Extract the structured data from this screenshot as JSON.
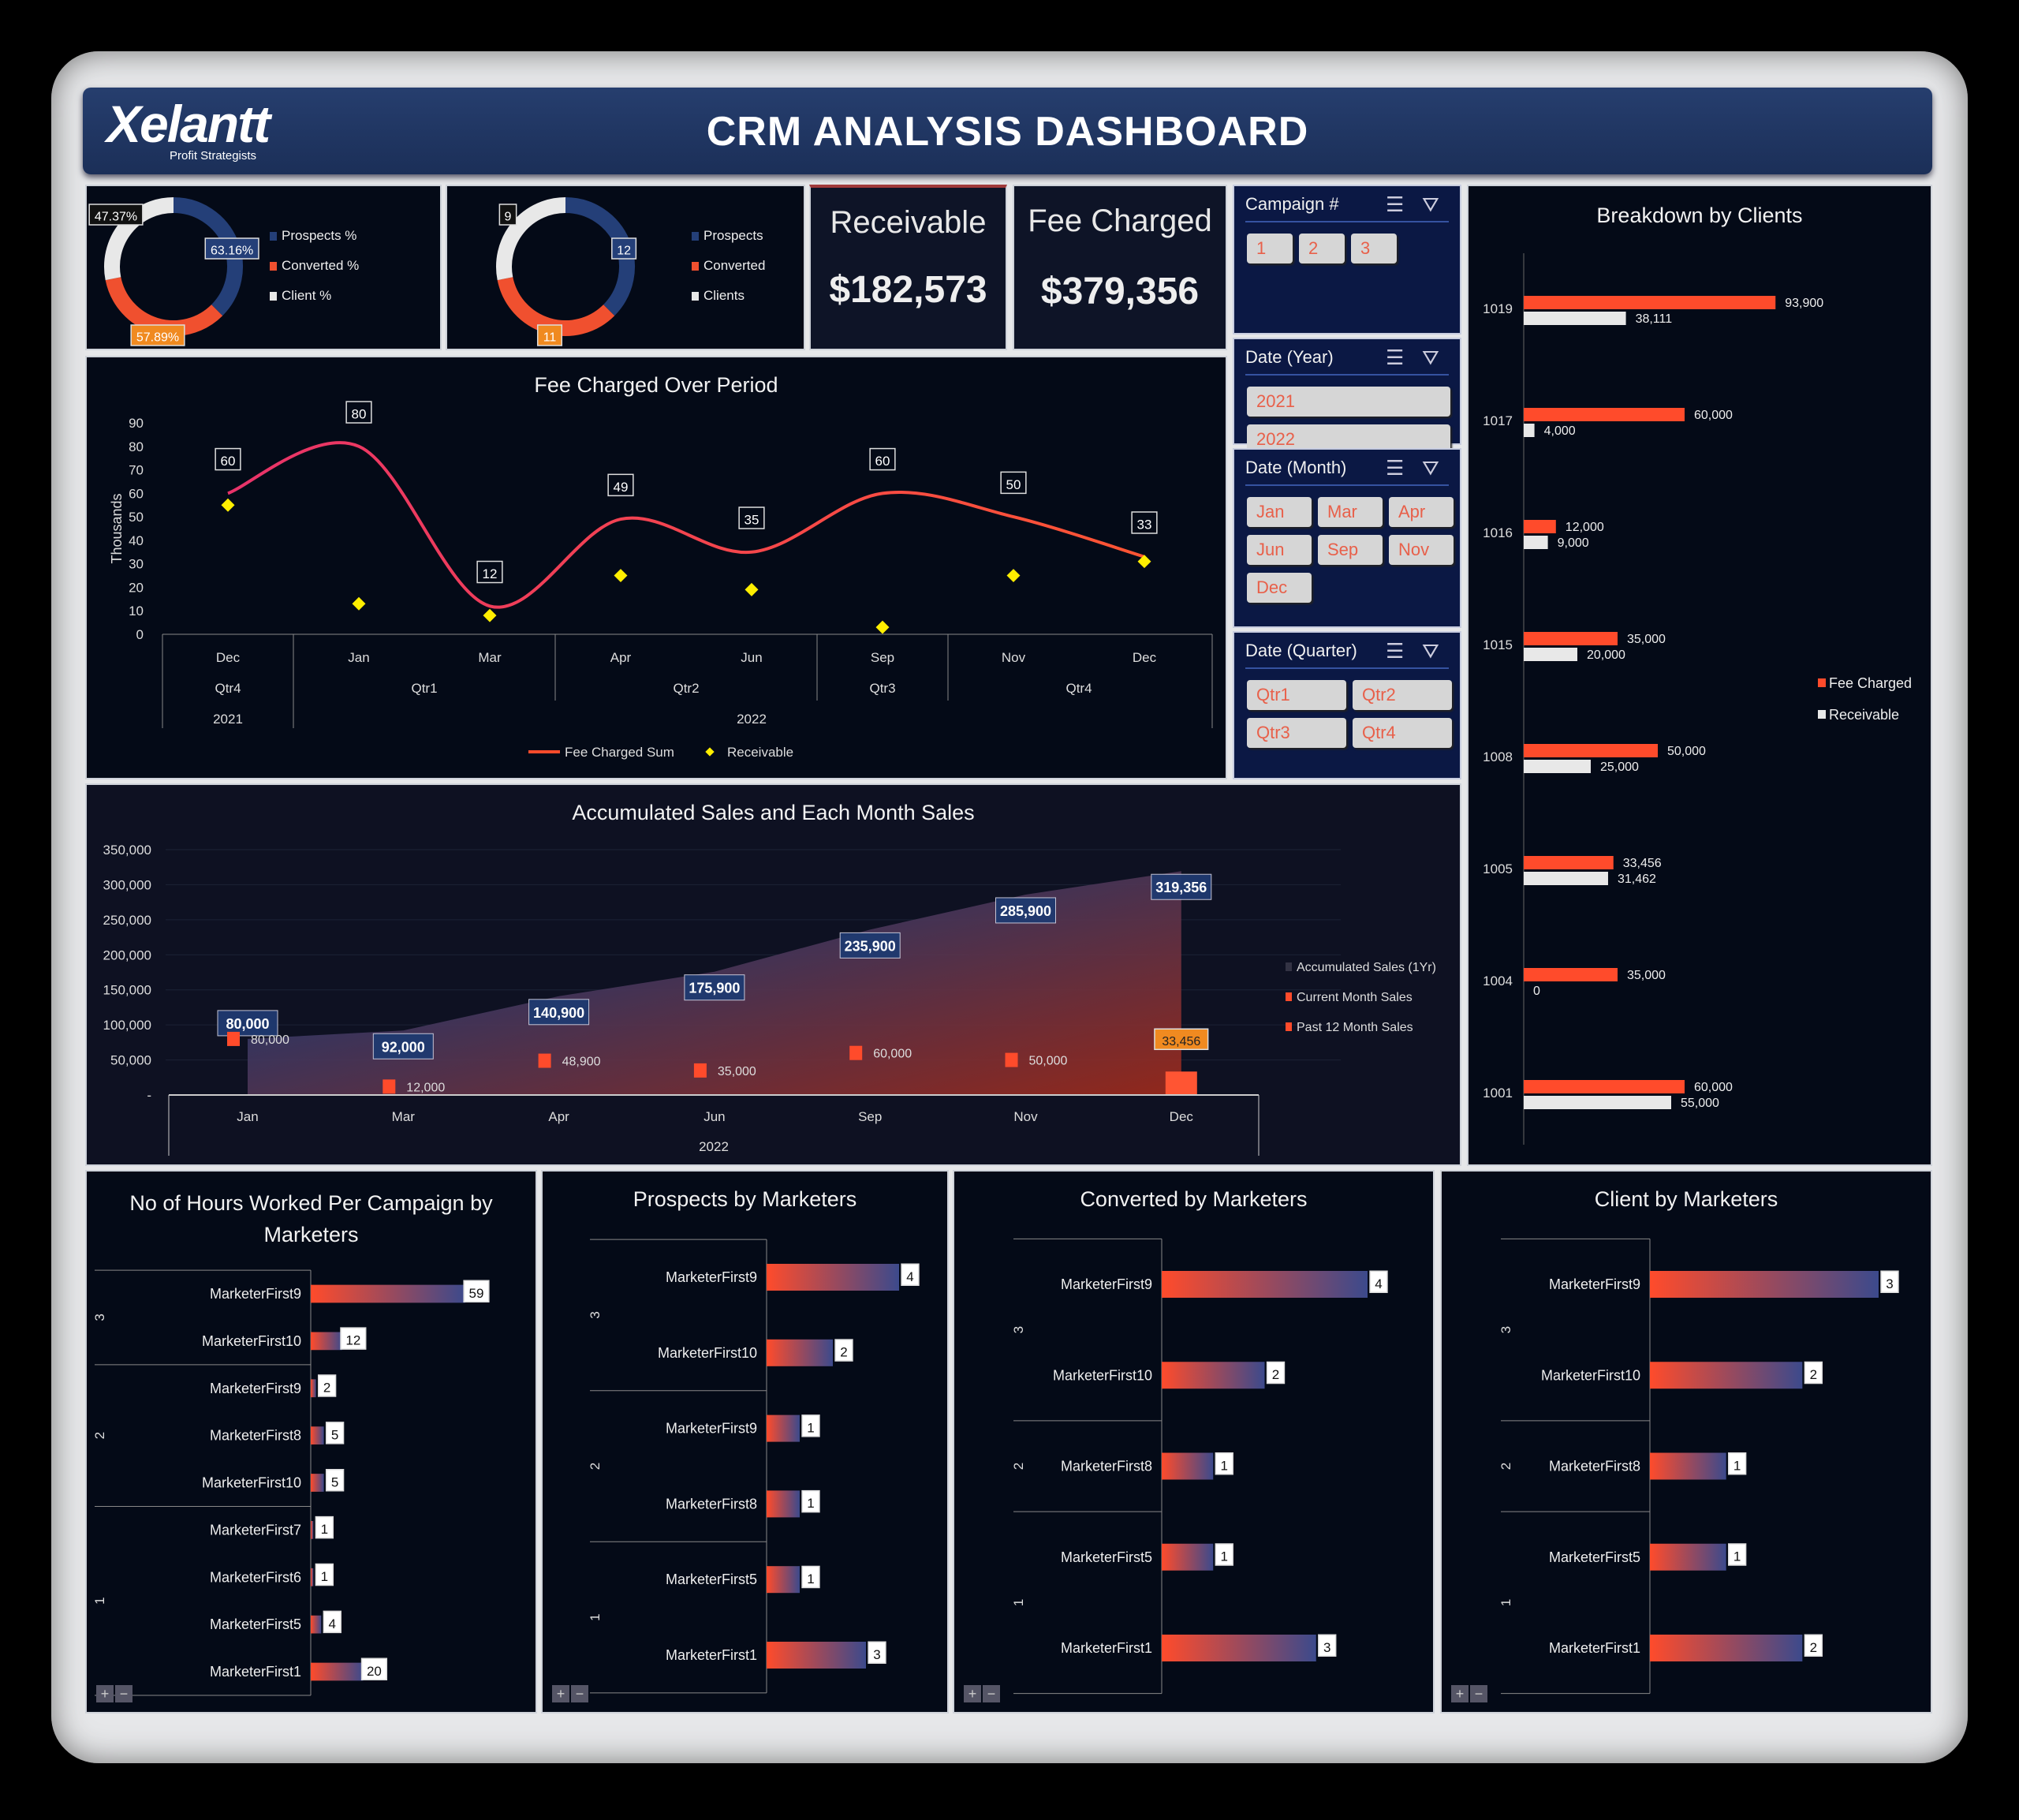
{
  "header": {
    "logo": "Xelantt",
    "logo_sub": "Profit Strategists",
    "title": "CRM ANALYSIS DASHBOARD"
  },
  "donut_pct": {
    "legend": [
      "Prospects %",
      "Converted %",
      "Client %"
    ],
    "values": [
      63.16,
      57.89,
      47.37
    ],
    "labels": [
      "63.16%",
      "57.89%",
      "47.37%"
    ],
    "colors": [
      "#243f78",
      "#f0502f",
      "#e8e8e8"
    ]
  },
  "donut_count": {
    "legend": [
      "Prospects",
      "Converted",
      "Clients"
    ],
    "values": [
      12,
      11,
      9
    ],
    "labels": [
      "12",
      "11",
      "9"
    ],
    "colors": [
      "#243f78",
      "#f0502f",
      "#e8e8e8"
    ]
  },
  "kpis": {
    "receivable_label": "Receivable",
    "receivable_value": "$182,573",
    "fee_label": "Fee Charged",
    "fee_value": "$379,356"
  },
  "slicers": [
    {
      "title": "Campaign #",
      "items": [
        "1",
        "2",
        "3"
      ]
    },
    {
      "title": "Date (Year)",
      "items": [
        "2021",
        "2022"
      ]
    },
    {
      "title": "Date (Month)",
      "items": [
        "Jan",
        "Mar",
        "Apr",
        "Jun",
        "Sep",
        "Nov",
        "Dec"
      ]
    },
    {
      "title": "Date (Quarter)",
      "items": [
        "Qtr1",
        "Qtr2",
        "Qtr3",
        "Qtr4"
      ]
    }
  ],
  "chart_data": [
    {
      "id": "fee",
      "type": "line",
      "title": "Fee Charged Over Period",
      "ylabel": "Thousands",
      "ylim": [
        0,
        90
      ],
      "yticks": [
        0,
        10,
        20,
        30,
        40,
        50,
        60,
        70,
        80,
        90
      ],
      "categories": [
        "Dec",
        "Jan",
        "Mar",
        "Apr",
        "Jun",
        "Sep",
        "Nov",
        "Dec"
      ],
      "quarters": [
        {
          "label": "Qtr4",
          "span": 1
        },
        {
          "label": "Qtr1",
          "span": 2
        },
        {
          "label": "Qtr2",
          "span": 2
        },
        {
          "label": "Qtr3",
          "span": 1
        },
        {
          "label": "Qtr4",
          "span": 2
        }
      ],
      "years": [
        {
          "label": "2021",
          "span": 1
        },
        {
          "label": "2022",
          "span": 7
        }
      ],
      "series": [
        {
          "name": "Fee Charged Sum",
          "values": [
            60,
            80,
            12,
            49,
            35,
            60,
            50,
            33
          ],
          "color": "#e8336a"
        },
        {
          "name": "Receivable",
          "values": [
            55,
            13,
            8,
            25,
            19,
            3,
            25,
            31
          ],
          "color": "#ffee00"
        }
      ]
    },
    {
      "id": "acc",
      "type": "area",
      "title": "Accumulated Sales and Each Month Sales",
      "ylim": [
        0,
        350000
      ],
      "yticks": [
        "-",
        "50,000",
        "100,000",
        "150,000",
        "200,000",
        "250,000",
        "300,000",
        "350,000"
      ],
      "categories": [
        "Jan",
        "Mar",
        "Apr",
        "Jun",
        "Sep",
        "Nov",
        "Dec"
      ],
      "year": "2022",
      "series": [
        {
          "name": "Accumulated Sales (1Yr)",
          "values": [
            80000,
            92000,
            140900,
            175900,
            235900,
            285900,
            319356
          ],
          "labels": [
            "80,000",
            "92,000",
            "140,900",
            "175,900",
            "235,900",
            "285,900",
            "319,356"
          ],
          "color": "#1e3c78"
        },
        {
          "name": "Current Month Sales",
          "values": [
            80000,
            12000,
            48900,
            35000,
            60000,
            50000,
            33456
          ],
          "labels": [
            "80,000",
            "12,000",
            "48,900",
            "35,000",
            "60,000",
            "50,000",
            "33,456"
          ],
          "color": "#ff4b2b"
        },
        {
          "name": "Past 12 Month Sales",
          "values": [
            null,
            null,
            null,
            null,
            null,
            null,
            33456
          ],
          "color": "#ff5533"
        }
      ]
    },
    {
      "id": "clients",
      "type": "bar",
      "title": "Breakdown by Clients",
      "categories": [
        "1019",
        "1017",
        "1016",
        "1015",
        "1008",
        "1005",
        "1004",
        "1001"
      ],
      "series": [
        {
          "name": "Fee Charged",
          "values": [
            93900,
            60000,
            12000,
            35000,
            50000,
            33456,
            35000,
            60000
          ],
          "labels": [
            "93,900",
            "60,000",
            "12,000",
            "35,000",
            "50,000",
            "33,456",
            "35,000",
            "60,000"
          ],
          "color": "#ff4b2b"
        },
        {
          "name": "Receivable",
          "values": [
            38111,
            4000,
            9000,
            20000,
            25000,
            31462,
            0,
            55000
          ],
          "labels": [
            "38,111",
            "4,000",
            "9,000",
            "20,000",
            "25,000",
            "31,462",
            "0",
            "55,000"
          ],
          "color": "#e8e8e8"
        }
      ]
    },
    {
      "id": "hours",
      "type": "bar",
      "title": "No of Hours Worked  Per Campaign by Marketers",
      "groups": [
        {
          "label": "3",
          "rows": [
            [
              "MarketerFirst9",
              59
            ],
            [
              "MarketerFirst10",
              12
            ]
          ]
        },
        {
          "label": "2",
          "rows": [
            [
              "MarketerFirst9",
              2
            ],
            [
              "MarketerFirst8",
              5
            ],
            [
              "MarketerFirst10",
              5
            ]
          ]
        },
        {
          "label": "1",
          "rows": [
            [
              "MarketerFirst7",
              1
            ],
            [
              "MarketerFirst6",
              1
            ],
            [
              "MarketerFirst5",
              4
            ],
            [
              "MarketerFirst1",
              20
            ]
          ]
        }
      ]
    },
    {
      "id": "prospects",
      "type": "bar",
      "title": "Prospects by Marketers",
      "groups": [
        {
          "label": "3",
          "rows": [
            [
              "MarketerFirst9",
              4
            ],
            [
              "MarketerFirst10",
              2
            ]
          ]
        },
        {
          "label": "2",
          "rows": [
            [
              "MarketerFirst9",
              1
            ],
            [
              "MarketerFirst8",
              1
            ]
          ]
        },
        {
          "label": "1",
          "rows": [
            [
              "MarketerFirst5",
              1
            ],
            [
              "MarketerFirst1",
              3
            ]
          ]
        }
      ]
    },
    {
      "id": "converted",
      "type": "bar",
      "title": "Converted by Marketers",
      "groups": [
        {
          "label": "3",
          "rows": [
            [
              "MarketerFirst9",
              4
            ],
            [
              "MarketerFirst10",
              2
            ]
          ]
        },
        {
          "label": "2",
          "rows": [
            [
              "MarketerFirst8",
              1
            ]
          ]
        },
        {
          "label": "1",
          "rows": [
            [
              "MarketerFirst5",
              1
            ],
            [
              "MarketerFirst1",
              3
            ]
          ]
        }
      ]
    },
    {
      "id": "client_mk",
      "type": "bar",
      "title": "Client by Marketers",
      "groups": [
        {
          "label": "3",
          "rows": [
            [
              "MarketerFirst9",
              3
            ],
            [
              "MarketerFirst10",
              2
            ]
          ]
        },
        {
          "label": "2",
          "rows": [
            [
              "MarketerFirst8",
              1
            ]
          ]
        },
        {
          "label": "1",
          "rows": [
            [
              "MarketerFirst5",
              1
            ],
            [
              "MarketerFirst1",
              2
            ]
          ]
        }
      ]
    }
  ],
  "outline_buttons": {
    "expand": "+",
    "collapse": "−"
  }
}
